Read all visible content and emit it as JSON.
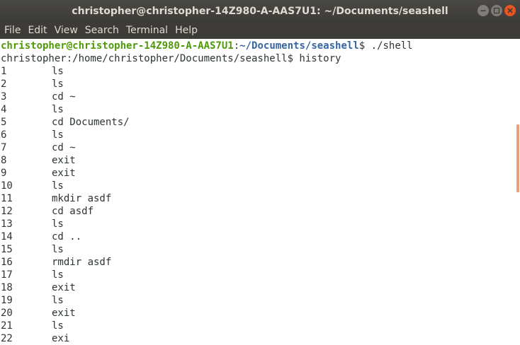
{
  "window": {
    "title": "christopher@christopher-14Z980-A-AAS7U1: ~/Documents/seashell"
  },
  "menu": [
    "File",
    "Edit",
    "View",
    "Search",
    "Terminal",
    "Help"
  ],
  "terminal": {
    "prompt": {
      "user_host": "christopher@christopher-14Z980-A-AAS7U1",
      "colon": ":",
      "path": "~/Documents/seashell",
      "dollar": "$ ",
      "command": "./shell"
    },
    "shell_prompt_line": "christopher:/home/christopher/Documents/seashell$ history",
    "history": [
      {
        "n": "1",
        "cmd": "ls"
      },
      {
        "n": "2",
        "cmd": "ls"
      },
      {
        "n": "3",
        "cmd": "cd ~"
      },
      {
        "n": "4",
        "cmd": "ls"
      },
      {
        "n": "5",
        "cmd": "cd Documents/"
      },
      {
        "n": "6",
        "cmd": "ls"
      },
      {
        "n": "7",
        "cmd": "cd ~"
      },
      {
        "n": "8",
        "cmd": "exit"
      },
      {
        "n": "9",
        "cmd": "exit"
      },
      {
        "n": "10",
        "cmd": "ls"
      },
      {
        "n": "11",
        "cmd": "mkdir asdf"
      },
      {
        "n": "12",
        "cmd": "cd asdf"
      },
      {
        "n": "13",
        "cmd": "ls"
      },
      {
        "n": "14",
        "cmd": "cd .."
      },
      {
        "n": "15",
        "cmd": "ls"
      },
      {
        "n": "16",
        "cmd": "rmdir asdf"
      },
      {
        "n": "17",
        "cmd": "ls"
      },
      {
        "n": "18",
        "cmd": "exit"
      },
      {
        "n": "19",
        "cmd": "ls"
      },
      {
        "n": "20",
        "cmd": "exit"
      },
      {
        "n": "21",
        "cmd": "ls"
      },
      {
        "n": "22",
        "cmd": "exi"
      }
    ]
  },
  "colors": {
    "titlebar": "#3c3b37",
    "close_button": "#e95420",
    "prompt_user": "#4e9a06",
    "prompt_path": "#3465a4",
    "scroll_thumb": "#e7a07e"
  },
  "icons": {
    "minimize": "minimize-icon",
    "maximize": "maximize-icon",
    "close": "close-icon"
  }
}
